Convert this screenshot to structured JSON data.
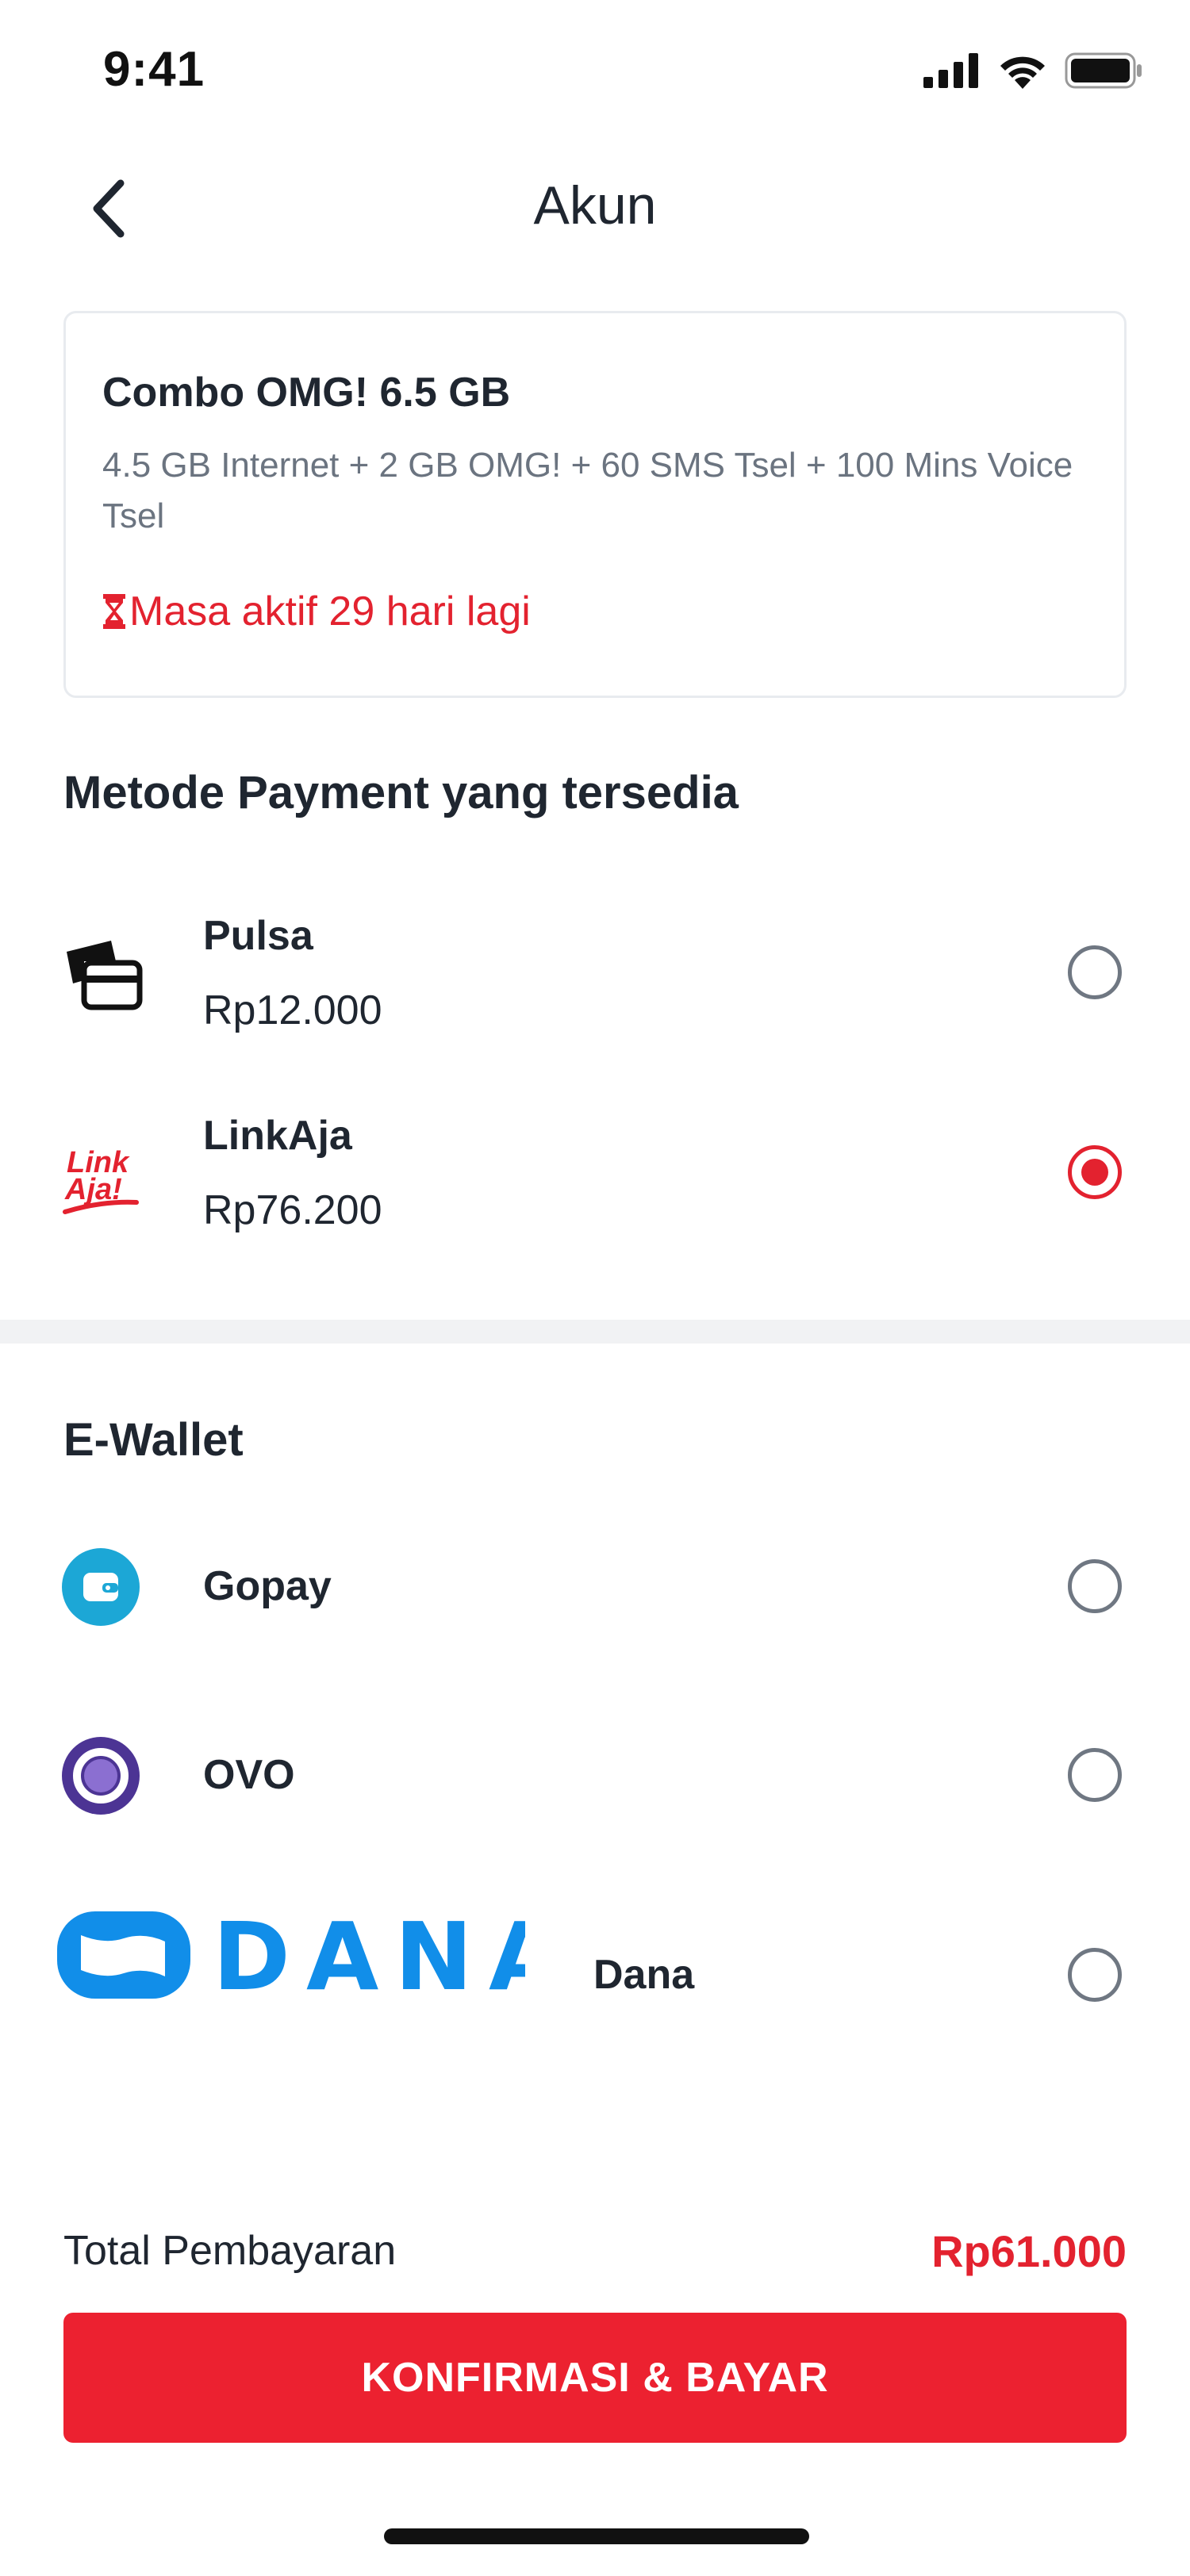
{
  "status_bar": {
    "time": "9:41"
  },
  "header": {
    "title": "Akun"
  },
  "package": {
    "name": "Combo OMG! 6.5 GB",
    "description": "4.5 GB Internet + 2 GB OMG! + 60 SMS Tsel + 100 Mins Voice Tsel",
    "expiry": "Masa aktif 29 hari lagi"
  },
  "payment_methods": {
    "title": "Metode Payment yang tersedia",
    "items": [
      {
        "name": "Pulsa",
        "price": "Rp12.000",
        "icon": "card-icon",
        "selected": false
      },
      {
        "name": "LinkAja",
        "price": "Rp76.200",
        "icon": "linkaja-logo",
        "logo_text_1": "Link",
        "logo_text_2": "Aja!",
        "selected": true
      }
    ]
  },
  "ewallet": {
    "title": "E-Wallet",
    "items": [
      {
        "name": "Gopay",
        "icon": "gopay-logo",
        "selected": false
      },
      {
        "name": "OVO",
        "icon": "ovo-logo",
        "selected": false
      },
      {
        "name": "Dana",
        "icon": "dana-logo",
        "logo_text": "DANA",
        "selected": false
      }
    ]
  },
  "footer": {
    "total_label": "Total Pembayaran",
    "total_value": "Rp61.000",
    "confirm_label": "KONFIRMASI & BAYAR"
  },
  "colors": {
    "accent": "#e3222f",
    "button": "#ec2130",
    "gopay": "#1ca7d6",
    "ovo": "#4c3494",
    "dana": "#118ee9"
  }
}
